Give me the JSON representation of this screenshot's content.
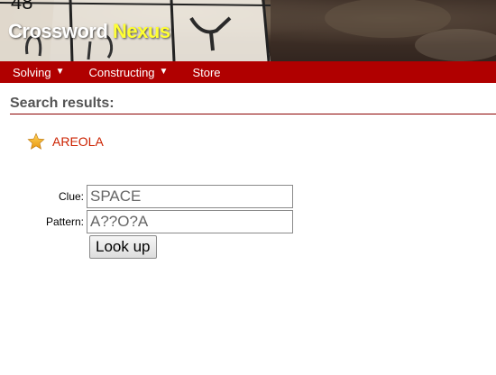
{
  "header": {
    "title_part1": "Crossword",
    "title_part2": "Nexus",
    "photo_number": "48",
    "photo_letter": "Y"
  },
  "nav": {
    "items": [
      {
        "label": "Solving",
        "has_dropdown": true
      },
      {
        "label": "Constructing",
        "has_dropdown": true
      },
      {
        "label": "Store",
        "has_dropdown": false
      }
    ],
    "caret": "▼",
    "background_color": "#b00000"
  },
  "main": {
    "section_title": "Search results:",
    "results": [
      {
        "word": "AREOLA",
        "icon": "star-icon"
      }
    ]
  },
  "form": {
    "clue_label": "Clue:",
    "clue_value": "SPACE",
    "pattern_label": "Pattern:",
    "pattern_value": "A??O?A",
    "button_label": "Look up"
  },
  "colors": {
    "accent_yellow": "#ffff33",
    "link_red": "#cc2200",
    "rule_dark_red": "#8b0000"
  }
}
